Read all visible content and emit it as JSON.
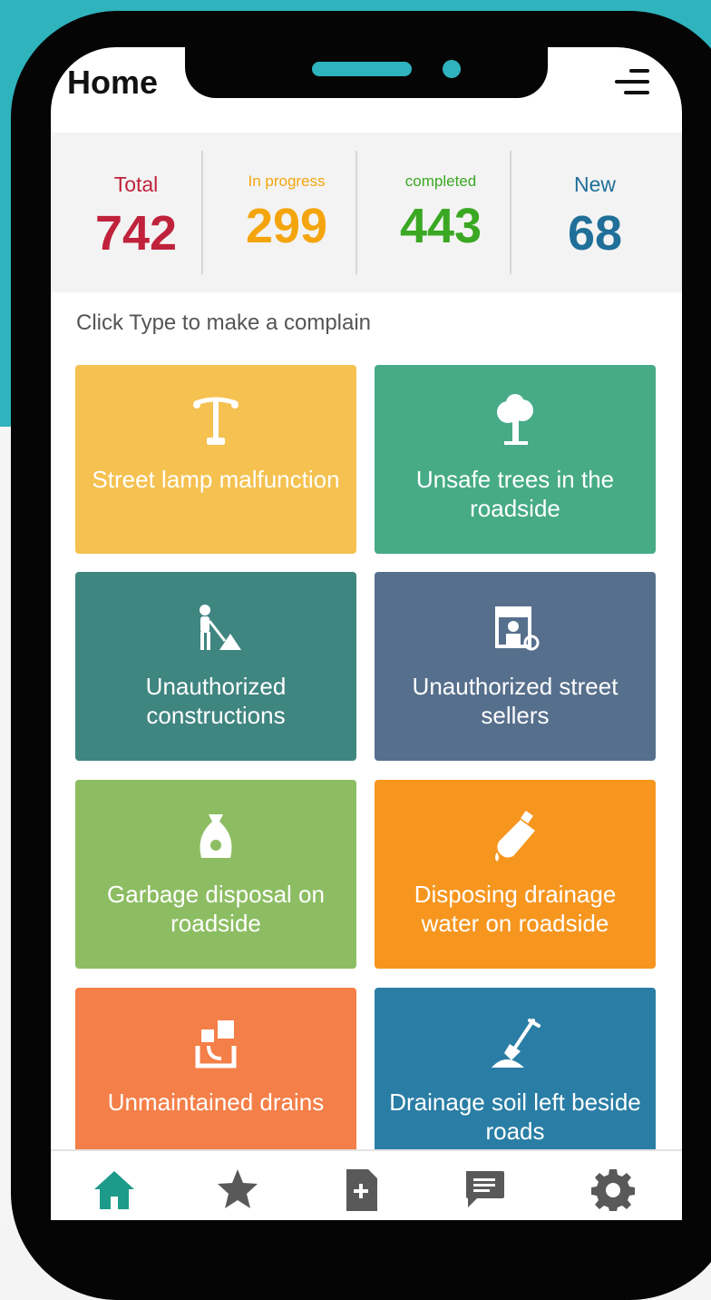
{
  "header": {
    "title": "Home"
  },
  "stats": [
    {
      "label": "Total",
      "value": "742",
      "color": "#c0223b"
    },
    {
      "label": "In progress",
      "value": "299",
      "color": "#f4a50e"
    },
    {
      "label": "completed",
      "value": "443",
      "color": "#3aa822"
    },
    {
      "label": "New",
      "value": "68",
      "color": "#1f6f99"
    }
  ],
  "prompt": "Click Type to make a complain",
  "tiles": [
    {
      "label": "Street lamp malfunction",
      "icon": "street-lamp-icon",
      "color": "#f5c150"
    },
    {
      "label": "Unsafe trees in the roadside",
      "icon": "tree-icon",
      "color": "#46ab86"
    },
    {
      "label": "Unauthorized constructions",
      "icon": "construction-worker-icon",
      "color": "#3f8580"
    },
    {
      "label": "Unauthorized street sellers",
      "icon": "street-seller-icon",
      "color": "#566f8c"
    },
    {
      "label": "Garbage disposal on roadside",
      "icon": "garbage-bag-icon",
      "color": "#8dbd63"
    },
    {
      "label": "Disposing drainage water on roadside",
      "icon": "bottle-drop-icon",
      "color": "#f6961f"
    },
    {
      "label": "Unmaintained drains",
      "icon": "drain-icon",
      "color": "#f47f48"
    },
    {
      "label": "Drainage soil left beside roads",
      "icon": "shovel-soil-icon",
      "color": "#2a7ea5"
    }
  ],
  "nav": [
    {
      "name": "home",
      "icon": "home-icon",
      "color": "#1d9a8a",
      "active": true
    },
    {
      "name": "favorites",
      "icon": "star-icon",
      "color": "#595959"
    },
    {
      "name": "new-complaint",
      "icon": "add-document-icon",
      "color": "#595959"
    },
    {
      "name": "messages",
      "icon": "chat-icon",
      "color": "#595959"
    },
    {
      "name": "settings",
      "icon": "gear-icon",
      "color": "#595959"
    }
  ]
}
